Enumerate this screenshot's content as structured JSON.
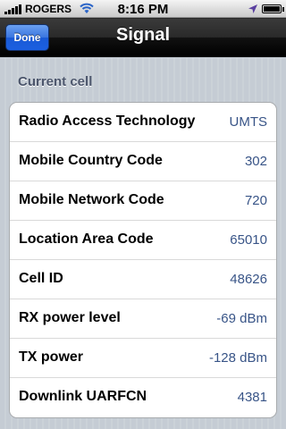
{
  "status_bar": {
    "carrier": "ROGERS",
    "time": "8:16 PM",
    "icons": [
      "signal-bars-icon",
      "wifi-icon",
      "location-arrow-icon",
      "battery-icon"
    ]
  },
  "nav": {
    "done_label": "Done",
    "title": "Signal"
  },
  "colors": {
    "nav_bar": "#2a2a2a",
    "done_button": "#2f6ce3",
    "value_text": "#385487",
    "section_header": "#4c566c",
    "background": "#c5ccd4"
  },
  "section": {
    "header": "Current cell",
    "rows": [
      {
        "label": "Radio Access Technology",
        "value": "UMTS"
      },
      {
        "label": "Mobile Country Code",
        "value": "302"
      },
      {
        "label": "Mobile Network Code",
        "value": "720"
      },
      {
        "label": "Location Area Code",
        "value": "65010"
      },
      {
        "label": "Cell ID",
        "value": "48626"
      },
      {
        "label": "RX power level",
        "value": "-69 dBm"
      },
      {
        "label": "TX power",
        "value": "-128 dBm"
      },
      {
        "label": "Downlink UARFCN",
        "value": "4381"
      }
    ]
  }
}
